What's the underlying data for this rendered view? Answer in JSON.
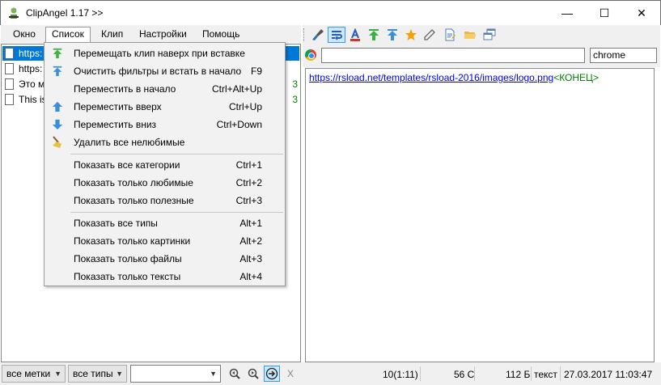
{
  "window": {
    "title": "ClipAngel 1.17 >>",
    "controls": {
      "minimize": "—",
      "maximize": "☐",
      "close": "✕"
    }
  },
  "menubar": {
    "items": [
      "Окно",
      "Список",
      "Клип",
      "Настройки",
      "Помощь"
    ],
    "active": "Список"
  },
  "clip_list": {
    "rows": [
      {
        "text": "https:",
        "selected": true,
        "count": ""
      },
      {
        "text": "https:",
        "selected": false,
        "count": ""
      },
      {
        "text": "Это м",
        "selected": false,
        "count": "3"
      },
      {
        "text": "This is",
        "selected": false,
        "count": "3"
      }
    ]
  },
  "dropdown": {
    "items": [
      {
        "label": "Перемещать клип наверх при вставке",
        "shortcut": "",
        "icon": "move-to-top-green-icon"
      },
      {
        "label": "Очистить фильтры и встать в начало",
        "shortcut": "F9",
        "icon": "clear-filters-icon"
      },
      {
        "label": "Переместить в начало",
        "shortcut": "Ctrl+Alt+Up",
        "icon": ""
      },
      {
        "label": "Переместить вверх",
        "shortcut": "Ctrl+Up",
        "icon": "move-up-icon"
      },
      {
        "label": "Переместить вниз",
        "shortcut": "Ctrl+Down",
        "icon": "move-down-icon"
      },
      {
        "label": "Удалить все нелюбимые",
        "shortcut": "",
        "icon": "broom-icon"
      },
      {
        "label": "Показать все категории",
        "shortcut": "Ctrl+1",
        "icon": ""
      },
      {
        "label": "Показать только любимые",
        "shortcut": "Ctrl+2",
        "icon": ""
      },
      {
        "label": "Показать только полезные",
        "shortcut": "Ctrl+3",
        "icon": ""
      },
      {
        "label": "Показать все типы",
        "shortcut": "Alt+1",
        "icon": ""
      },
      {
        "label": "Показать только картинки",
        "shortcut": "Alt+2",
        "icon": ""
      },
      {
        "label": "Показать только файлы",
        "shortcut": "Alt+3",
        "icon": ""
      },
      {
        "label": "Показать только тексты",
        "shortcut": "Alt+4",
        "icon": ""
      }
    ]
  },
  "toolbar": {
    "icons": [
      "brush-icon",
      "word-wrap-icon",
      "font-color-icon",
      "move-top-icon",
      "move-top-blue-icon",
      "favorite-star-icon",
      "edit-pencil-icon",
      "document-icon",
      "folder-icon",
      "windows-icon"
    ],
    "pressed": "word-wrap-icon"
  },
  "source": {
    "url": "",
    "app": "chrome"
  },
  "clip_text": {
    "link": "https://rsload.net/templates/rsload-2016/images/logo.png",
    "end_marker": "<КОНЕЦ>"
  },
  "bottom": {
    "tags_filter": "все метки",
    "types_filter": "все типы",
    "search": "",
    "clear": "X",
    "status_position": "10(1:11)",
    "status_chars": "56 С",
    "status_size": "112 Б",
    "status_type": "текст",
    "status_time": "27.03.2017 11:03:47"
  },
  "colors": {
    "selection": "#0078d7",
    "link": "#0000ee",
    "end_marker": "#008000",
    "accent_green": "#3cb043",
    "accent_blue": "#3a8fd8"
  }
}
